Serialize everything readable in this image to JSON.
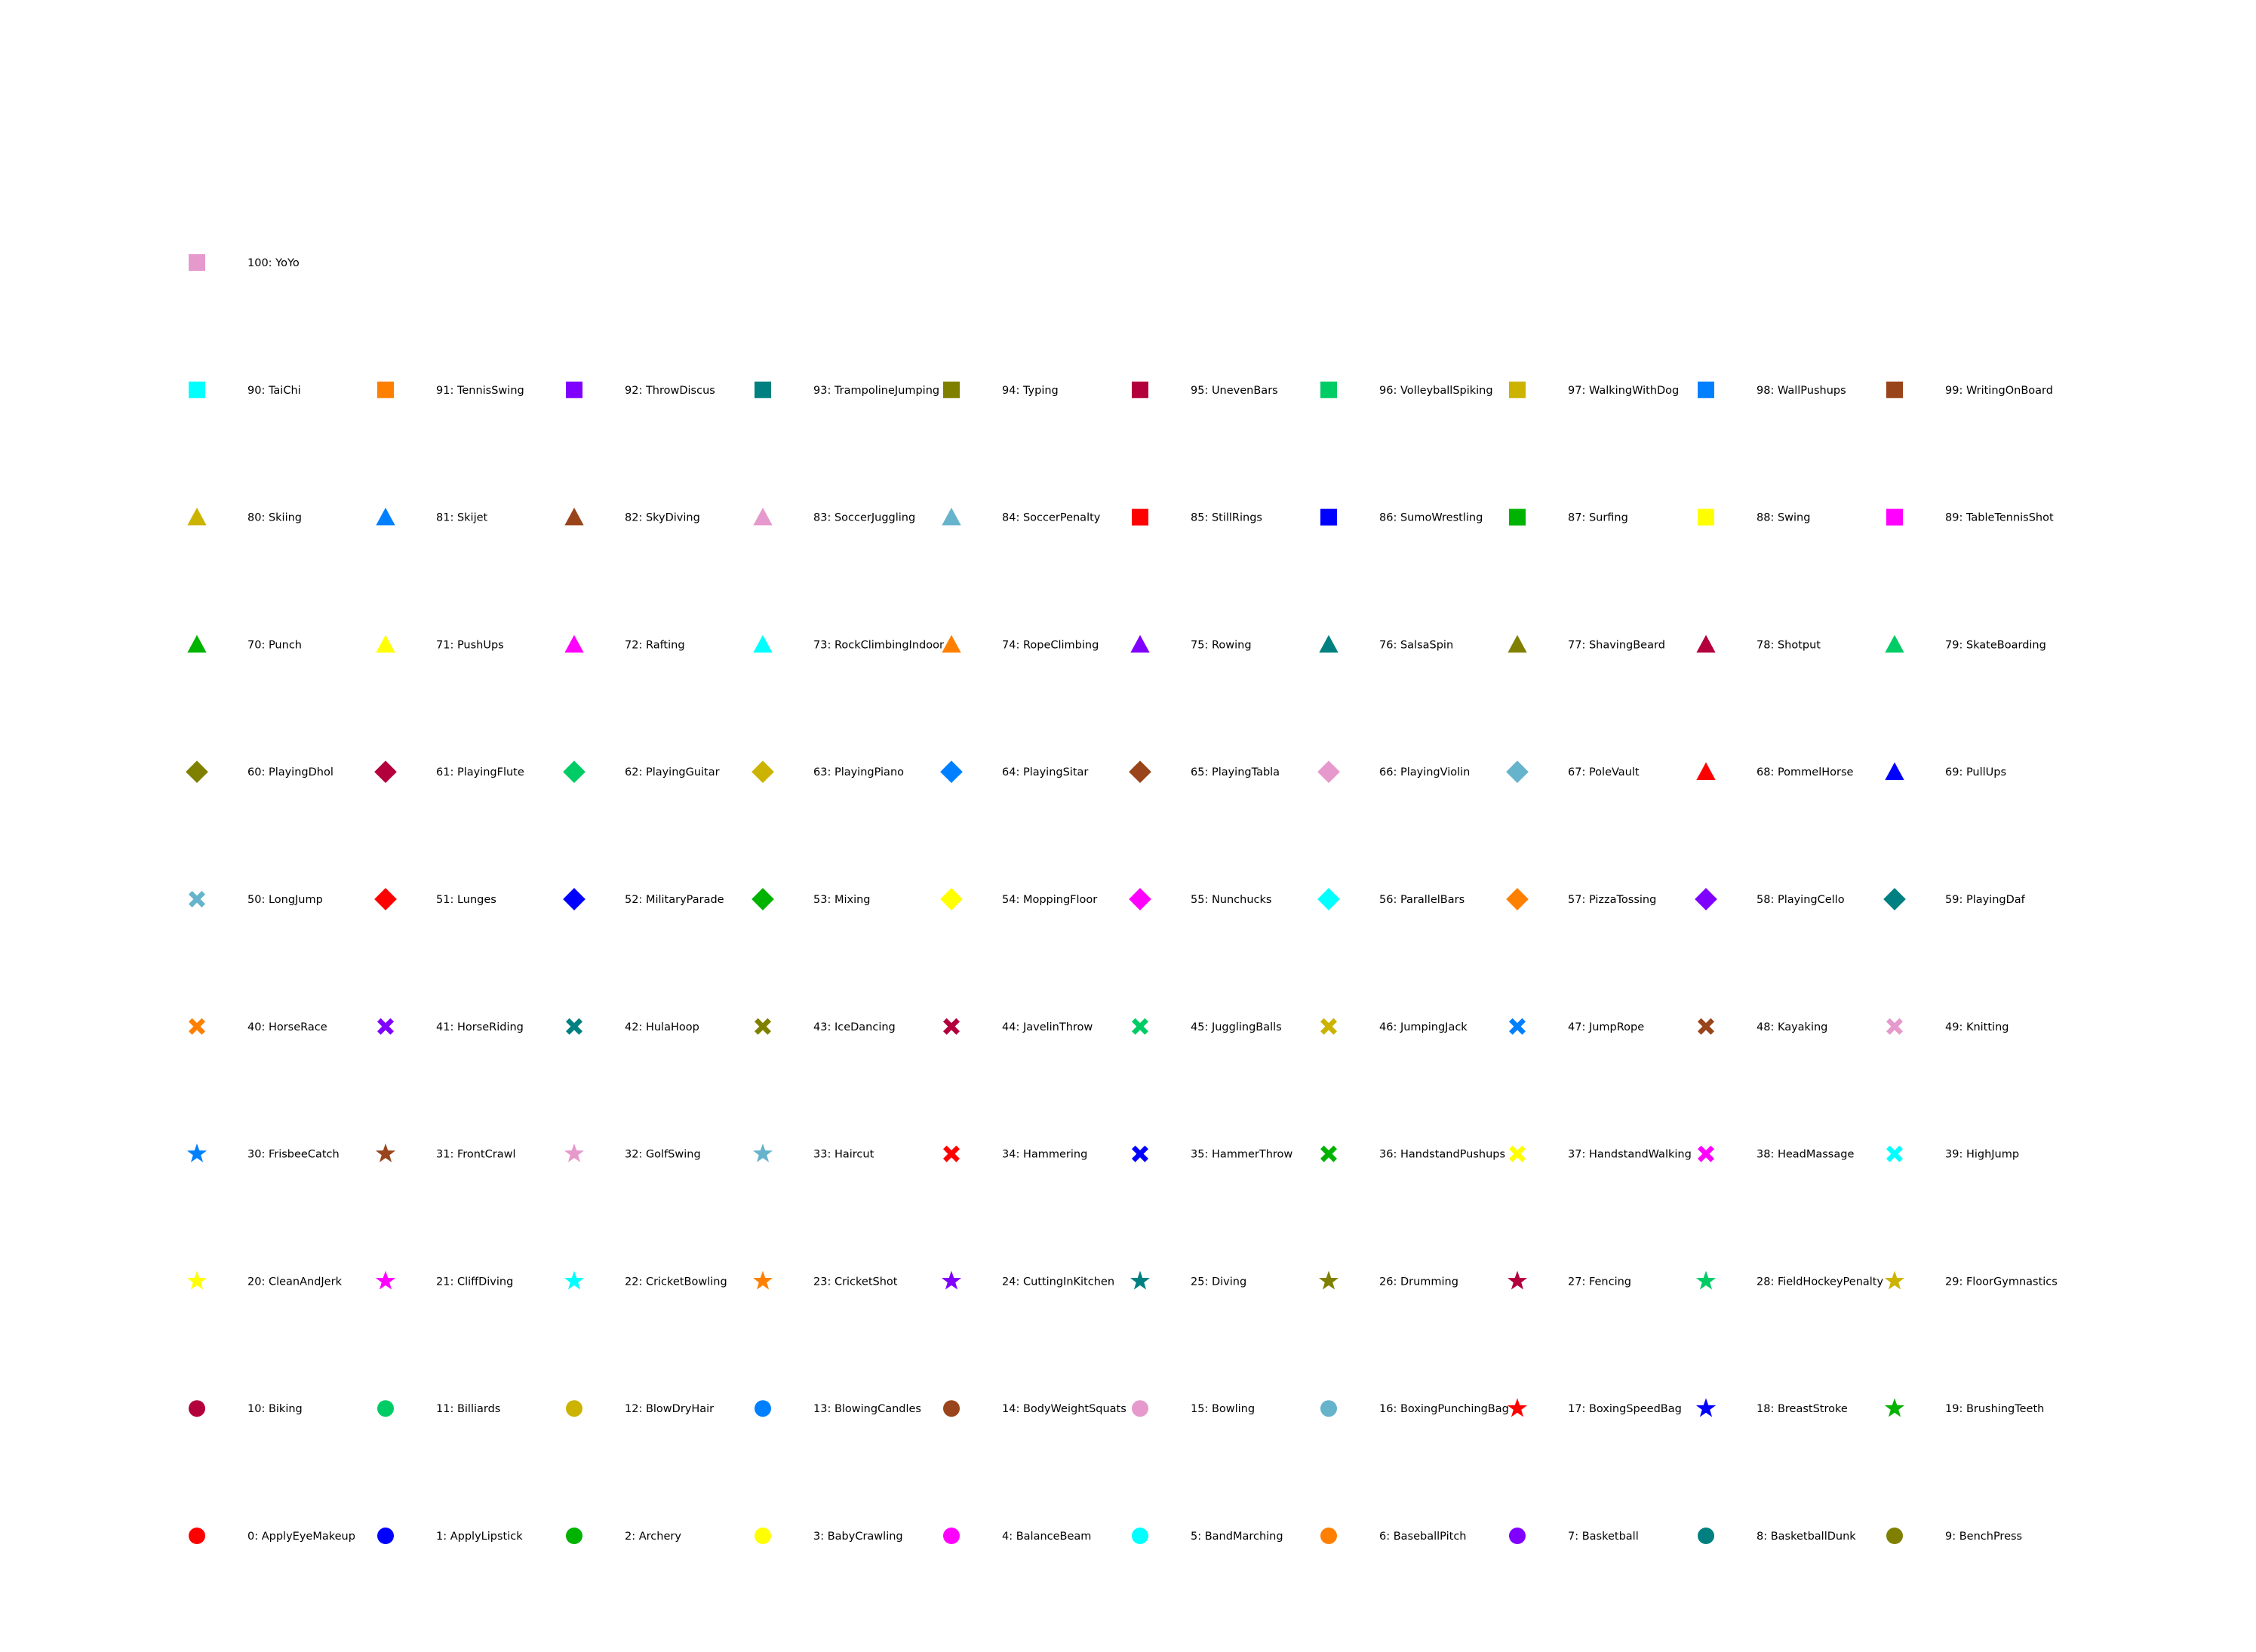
{
  "chart_data": {
    "type": "scatter",
    "title": "",
    "xlabel": "",
    "ylabel": "",
    "grid": false,
    "axes_visible": false,
    "columns": 10,
    "marker_order": [
      "circle",
      "star",
      "x-filled",
      "diamond",
      "triangle-up",
      "square"
    ],
    "palette": [
      "#ff0000",
      "#0000ff",
      "#00b300",
      "#ffff00",
      "#ff00ff",
      "#00ffff",
      "#ff8000",
      "#8000ff",
      "#008080",
      "#808000",
      "#b3003c",
      "#00cc66",
      "#ccb300",
      "#0080ff",
      "#99441a",
      "#e699cc",
      "#66b3cc"
    ],
    "points": [
      {
        "index": 0,
        "label": "0: ApplyEyeMakeup",
        "marker": "circle",
        "color": "#ff0000"
      },
      {
        "index": 1,
        "label": "1: ApplyLipstick",
        "marker": "circle",
        "color": "#0000ff"
      },
      {
        "index": 2,
        "label": "2: Archery",
        "marker": "circle",
        "color": "#00b300"
      },
      {
        "index": 3,
        "label": "3: BabyCrawling",
        "marker": "circle",
        "color": "#ffff00"
      },
      {
        "index": 4,
        "label": "4: BalanceBeam",
        "marker": "circle",
        "color": "#ff00ff"
      },
      {
        "index": 5,
        "label": "5: BandMarching",
        "marker": "circle",
        "color": "#00ffff"
      },
      {
        "index": 6,
        "label": "6: BaseballPitch",
        "marker": "circle",
        "color": "#ff8000"
      },
      {
        "index": 7,
        "label": "7: Basketball",
        "marker": "circle",
        "color": "#8000ff"
      },
      {
        "index": 8,
        "label": "8: BasketballDunk",
        "marker": "circle",
        "color": "#008080"
      },
      {
        "index": 9,
        "label": "9: BenchPress",
        "marker": "circle",
        "color": "#808000"
      },
      {
        "index": 10,
        "label": "10: Biking",
        "marker": "circle",
        "color": "#b3003c"
      },
      {
        "index": 11,
        "label": "11: Billiards",
        "marker": "circle",
        "color": "#00cc66"
      },
      {
        "index": 12,
        "label": "12: BlowDryHair",
        "marker": "circle",
        "color": "#ccb300"
      },
      {
        "index": 13,
        "label": "13: BlowingCandles",
        "marker": "circle",
        "color": "#0080ff"
      },
      {
        "index": 14,
        "label": "14: BodyWeightSquats",
        "marker": "circle",
        "color": "#99441a"
      },
      {
        "index": 15,
        "label": "15: Bowling",
        "marker": "circle",
        "color": "#e699cc"
      },
      {
        "index": 16,
        "label": "16: BoxingPunchingBag",
        "marker": "circle",
        "color": "#66b3cc"
      },
      {
        "index": 17,
        "label": "17: BoxingSpeedBag",
        "marker": "star",
        "color": "#ff0000"
      },
      {
        "index": 18,
        "label": "18: BreastStroke",
        "marker": "star",
        "color": "#0000ff"
      },
      {
        "index": 19,
        "label": "19: BrushingTeeth",
        "marker": "star",
        "color": "#00b300"
      },
      {
        "index": 20,
        "label": "20: CleanAndJerk",
        "marker": "star",
        "color": "#ffff00"
      },
      {
        "index": 21,
        "label": "21: CliffDiving",
        "marker": "star",
        "color": "#ff00ff"
      },
      {
        "index": 22,
        "label": "22: CricketBowling",
        "marker": "star",
        "color": "#00ffff"
      },
      {
        "index": 23,
        "label": "23: CricketShot",
        "marker": "star",
        "color": "#ff8000"
      },
      {
        "index": 24,
        "label": "24: CuttingInKitchen",
        "marker": "star",
        "color": "#8000ff"
      },
      {
        "index": 25,
        "label": "25: Diving",
        "marker": "star",
        "color": "#008080"
      },
      {
        "index": 26,
        "label": "26: Drumming",
        "marker": "star",
        "color": "#808000"
      },
      {
        "index": 27,
        "label": "27: Fencing",
        "marker": "star",
        "color": "#b3003c"
      },
      {
        "index": 28,
        "label": "28: FieldHockeyPenalty",
        "marker": "star",
        "color": "#00cc66"
      },
      {
        "index": 29,
        "label": "29: FloorGymnastics",
        "marker": "star",
        "color": "#ccb300"
      },
      {
        "index": 30,
        "label": "30: FrisbeeCatch",
        "marker": "star",
        "color": "#0080ff"
      },
      {
        "index": 31,
        "label": "31: FrontCrawl",
        "marker": "star",
        "color": "#99441a"
      },
      {
        "index": 32,
        "label": "32: GolfSwing",
        "marker": "star",
        "color": "#e699cc"
      },
      {
        "index": 33,
        "label": "33: Haircut",
        "marker": "star",
        "color": "#66b3cc"
      },
      {
        "index": 34,
        "label": "34: Hammering",
        "marker": "x-filled",
        "color": "#ff0000"
      },
      {
        "index": 35,
        "label": "35: HammerThrow",
        "marker": "x-filled",
        "color": "#0000ff"
      },
      {
        "index": 36,
        "label": "36: HandstandPushups",
        "marker": "x-filled",
        "color": "#00b300"
      },
      {
        "index": 37,
        "label": "37: HandstandWalking",
        "marker": "x-filled",
        "color": "#ffff00"
      },
      {
        "index": 38,
        "label": "38: HeadMassage",
        "marker": "x-filled",
        "color": "#ff00ff"
      },
      {
        "index": 39,
        "label": "39: HighJump",
        "marker": "x-filled",
        "color": "#00ffff"
      },
      {
        "index": 40,
        "label": "40: HorseRace",
        "marker": "x-filled",
        "color": "#ff8000"
      },
      {
        "index": 41,
        "label": "41: HorseRiding",
        "marker": "x-filled",
        "color": "#8000ff"
      },
      {
        "index": 42,
        "label": "42: HulaHoop",
        "marker": "x-filled",
        "color": "#008080"
      },
      {
        "index": 43,
        "label": "43: IceDancing",
        "marker": "x-filled",
        "color": "#808000"
      },
      {
        "index": 44,
        "label": "44: JavelinThrow",
        "marker": "x-filled",
        "color": "#b3003c"
      },
      {
        "index": 45,
        "label": "45: JugglingBalls",
        "marker": "x-filled",
        "color": "#00cc66"
      },
      {
        "index": 46,
        "label": "46: JumpingJack",
        "marker": "x-filled",
        "color": "#ccb300"
      },
      {
        "index": 47,
        "label": "47: JumpRope",
        "marker": "x-filled",
        "color": "#0080ff"
      },
      {
        "index": 48,
        "label": "48: Kayaking",
        "marker": "x-filled",
        "color": "#99441a"
      },
      {
        "index": 49,
        "label": "49: Knitting",
        "marker": "x-filled",
        "color": "#e699cc"
      },
      {
        "index": 50,
        "label": "50: LongJump",
        "marker": "x-filled",
        "color": "#66b3cc"
      },
      {
        "index": 51,
        "label": "51: Lunges",
        "marker": "diamond",
        "color": "#ff0000"
      },
      {
        "index": 52,
        "label": "52: MilitaryParade",
        "marker": "diamond",
        "color": "#0000ff"
      },
      {
        "index": 53,
        "label": "53: Mixing",
        "marker": "diamond",
        "color": "#00b300"
      },
      {
        "index": 54,
        "label": "54: MoppingFloor",
        "marker": "diamond",
        "color": "#ffff00"
      },
      {
        "index": 55,
        "label": "55: Nunchucks",
        "marker": "diamond",
        "color": "#ff00ff"
      },
      {
        "index": 56,
        "label": "56: ParallelBars",
        "marker": "diamond",
        "color": "#00ffff"
      },
      {
        "index": 57,
        "label": "57: PizzaTossing",
        "marker": "diamond",
        "color": "#ff8000"
      },
      {
        "index": 58,
        "label": "58: PlayingCello",
        "marker": "diamond",
        "color": "#8000ff"
      },
      {
        "index": 59,
        "label": "59: PlayingDaf",
        "marker": "diamond",
        "color": "#008080"
      },
      {
        "index": 60,
        "label": "60: PlayingDhol",
        "marker": "diamond",
        "color": "#808000"
      },
      {
        "index": 61,
        "label": "61: PlayingFlute",
        "marker": "diamond",
        "color": "#b3003c"
      },
      {
        "index": 62,
        "label": "62: PlayingGuitar",
        "marker": "diamond",
        "color": "#00cc66"
      },
      {
        "index": 63,
        "label": "63: PlayingPiano",
        "marker": "diamond",
        "color": "#ccb300"
      },
      {
        "index": 64,
        "label": "64: PlayingSitar",
        "marker": "diamond",
        "color": "#0080ff"
      },
      {
        "index": 65,
        "label": "65: PlayingTabla",
        "marker": "diamond",
        "color": "#99441a"
      },
      {
        "index": 66,
        "label": "66: PlayingViolin",
        "marker": "diamond",
        "color": "#e699cc"
      },
      {
        "index": 67,
        "label": "67: PoleVault",
        "marker": "diamond",
        "color": "#66b3cc"
      },
      {
        "index": 68,
        "label": "68: PommelHorse",
        "marker": "triangle-up",
        "color": "#ff0000"
      },
      {
        "index": 69,
        "label": "69: PullUps",
        "marker": "triangle-up",
        "color": "#0000ff"
      },
      {
        "index": 70,
        "label": "70: Punch",
        "marker": "triangle-up",
        "color": "#00b300"
      },
      {
        "index": 71,
        "label": "71: PushUps",
        "marker": "triangle-up",
        "color": "#ffff00"
      },
      {
        "index": 72,
        "label": "72: Rafting",
        "marker": "triangle-up",
        "color": "#ff00ff"
      },
      {
        "index": 73,
        "label": "73: RockClimbingIndoor",
        "marker": "triangle-up",
        "color": "#00ffff"
      },
      {
        "index": 74,
        "label": "74: RopeClimbing",
        "marker": "triangle-up",
        "color": "#ff8000"
      },
      {
        "index": 75,
        "label": "75: Rowing",
        "marker": "triangle-up",
        "color": "#8000ff"
      },
      {
        "index": 76,
        "label": "76: SalsaSpin",
        "marker": "triangle-up",
        "color": "#008080"
      },
      {
        "index": 77,
        "label": "77: ShavingBeard",
        "marker": "triangle-up",
        "color": "#808000"
      },
      {
        "index": 78,
        "label": "78: Shotput",
        "marker": "triangle-up",
        "color": "#b3003c"
      },
      {
        "index": 79,
        "label": "79: SkateBoarding",
        "marker": "triangle-up",
        "color": "#00cc66"
      },
      {
        "index": 80,
        "label": "80: Skiing",
        "marker": "triangle-up",
        "color": "#ccb300"
      },
      {
        "index": 81,
        "label": "81: Skijet",
        "marker": "triangle-up",
        "color": "#0080ff"
      },
      {
        "index": 82,
        "label": "82: SkyDiving",
        "marker": "triangle-up",
        "color": "#99441a"
      },
      {
        "index": 83,
        "label": "83: SoccerJuggling",
        "marker": "triangle-up",
        "color": "#e699cc"
      },
      {
        "index": 84,
        "label": "84: SoccerPenalty",
        "marker": "triangle-up",
        "color": "#66b3cc"
      },
      {
        "index": 85,
        "label": "85: StillRings",
        "marker": "square",
        "color": "#ff0000"
      },
      {
        "index": 86,
        "label": "86: SumoWrestling",
        "marker": "square",
        "color": "#0000ff"
      },
      {
        "index": 87,
        "label": "87: Surfing",
        "marker": "square",
        "color": "#00b300"
      },
      {
        "index": 88,
        "label": "88: Swing",
        "marker": "square",
        "color": "#ffff00"
      },
      {
        "index": 89,
        "label": "89: TableTennisShot",
        "marker": "square",
        "color": "#ff00ff"
      },
      {
        "index": 90,
        "label": "90: TaiChi",
        "marker": "square",
        "color": "#00ffff"
      },
      {
        "index": 91,
        "label": "91: TennisSwing",
        "marker": "square",
        "color": "#ff8000"
      },
      {
        "index": 92,
        "label": "92: ThrowDiscus",
        "marker": "square",
        "color": "#8000ff"
      },
      {
        "index": 93,
        "label": "93: TrampolineJumping",
        "marker": "square",
        "color": "#008080"
      },
      {
        "index": 94,
        "label": "94: Typing",
        "marker": "square",
        "color": "#808000"
      },
      {
        "index": 95,
        "label": "95: UnevenBars",
        "marker": "square",
        "color": "#b3003c"
      },
      {
        "index": 96,
        "label": "96: VolleyballSpiking",
        "marker": "square",
        "color": "#00cc66"
      },
      {
        "index": 97,
        "label": "97: WalkingWithDog",
        "marker": "square",
        "color": "#ccb300"
      },
      {
        "index": 98,
        "label": "98: WallPushups",
        "marker": "square",
        "color": "#0080ff"
      },
      {
        "index": 99,
        "label": "99: WritingOnBoard",
        "marker": "square",
        "color": "#99441a"
      },
      {
        "index": 100,
        "label": "100: YoYo",
        "marker": "square",
        "color": "#e699cc"
      }
    ]
  }
}
